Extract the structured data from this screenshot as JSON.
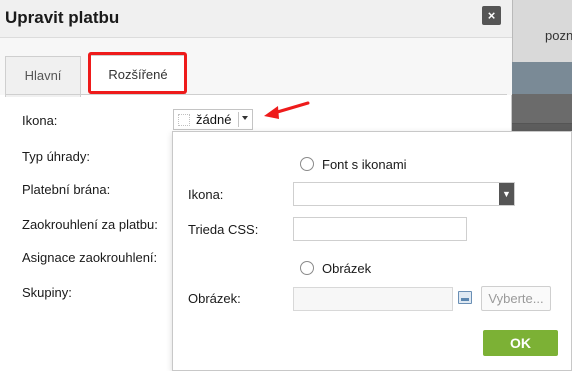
{
  "dialog": {
    "title": "Upravit platbu",
    "close_label": "×"
  },
  "tabs": [
    {
      "label": "Hlavní",
      "active": false
    },
    {
      "label": "Rozšířené",
      "active": true
    }
  ],
  "fields": {
    "ikona_label": "Ikona:",
    "typ_uhrady_label": "Typ úhrady:",
    "platebni_brana_label": "Platební brána:",
    "zaokrouhleni_label": "Zaokrouhlení za platbu:",
    "asignace_label": "Asignace zaokrouhlení:",
    "skupiny_label": "Skupiny:"
  },
  "icon_select": {
    "value": "žádné"
  },
  "popup": {
    "font_radio_label": "Font s ikonami",
    "ikona_label": "Ikona:",
    "trieda_css_label": "Trieda CSS:",
    "image_radio_label": "Obrázek",
    "obrazek_label": "Obrázek:",
    "browse_label": "Vyberte...",
    "ok_label": "OK"
  },
  "background": {
    "header_text": "pozn"
  },
  "colors": {
    "highlight": "#ee1b1b",
    "ok_green": "#7cb135",
    "close_dark": "#555555"
  }
}
